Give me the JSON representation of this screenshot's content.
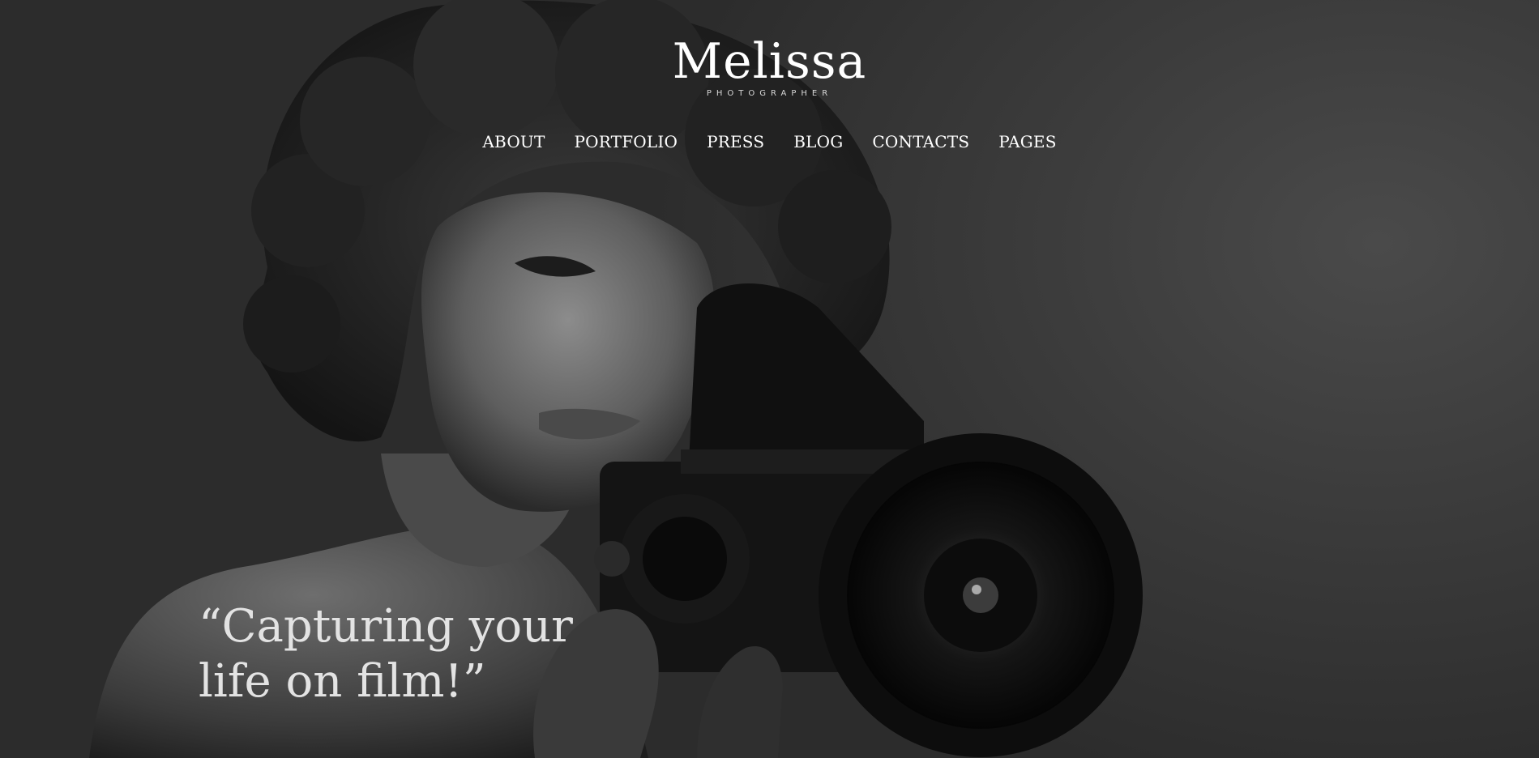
{
  "brand": {
    "name": "Melissa",
    "tagline": "PHOTOGRAPHER"
  },
  "nav": {
    "items": [
      {
        "label": "ABOUT"
      },
      {
        "label": "PORTFOLIO"
      },
      {
        "label": "PRESS"
      },
      {
        "label": "BLOG"
      },
      {
        "label": "CONTACTS"
      },
      {
        "label": "PAGES"
      }
    ]
  },
  "hero": {
    "quote": "“Capturing your life on film!”"
  },
  "colors": {
    "background": "#2b2b2b",
    "text": "#ffffff",
    "quote_text": "#e3e3e3"
  }
}
